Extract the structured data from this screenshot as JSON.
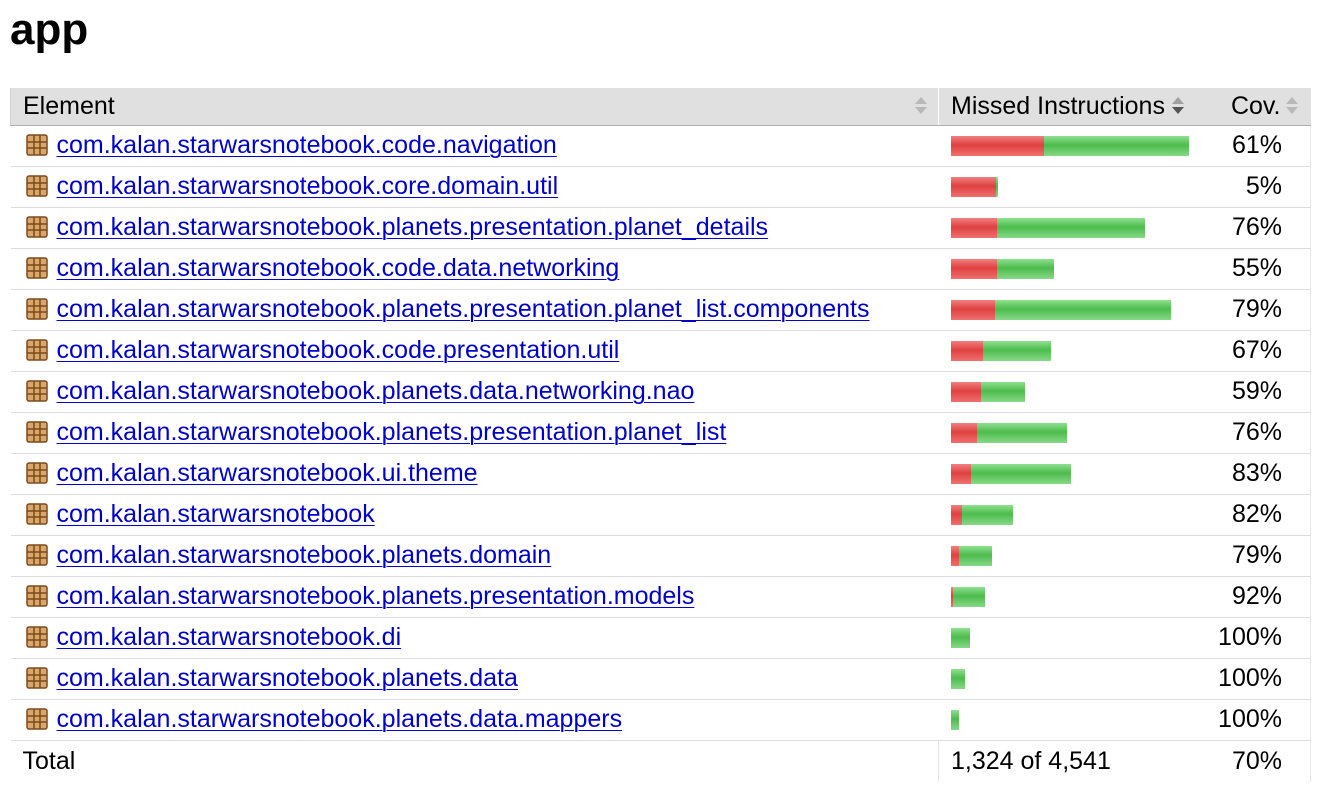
{
  "page": {
    "title": "app"
  },
  "colors": {
    "missed": "#e04040",
    "covered": "#4cbc4c",
    "header_bg": "#e0e0e0",
    "link": "#0000cc"
  },
  "table": {
    "headers": {
      "element": "Element",
      "missed": "Missed Instructions",
      "coverage": "Cov."
    },
    "sort": {
      "active_column": "missed",
      "direction": "descending"
    },
    "max_bar_total": 1000,
    "rows": [
      {
        "icon": "package-icon",
        "name": "com.kalan.starwarsnotebook.code.navigation",
        "missed": 390,
        "covered": 610,
        "coverage": "61%"
      },
      {
        "icon": "package-icon",
        "name": "com.kalan.starwarsnotebook.core.domain.util",
        "missed": 190,
        "covered": 10,
        "coverage": "5%"
      },
      {
        "icon": "package-icon",
        "name": "com.kalan.starwarsnotebook.planets.presentation.planet_details",
        "missed": 195,
        "covered": 620,
        "coverage": "76%"
      },
      {
        "icon": "package-icon",
        "name": "com.kalan.starwarsnotebook.code.data.networking",
        "missed": 195,
        "covered": 240,
        "coverage": "55%"
      },
      {
        "icon": "package-icon",
        "name": "com.kalan.starwarsnotebook.planets.presentation.planet_list.components",
        "missed": 185,
        "covered": 740,
        "coverage": "79%"
      },
      {
        "icon": "package-icon",
        "name": "com.kalan.starwarsnotebook.code.presentation.util",
        "missed": 135,
        "covered": 285,
        "coverage": "67%"
      },
      {
        "icon": "package-icon",
        "name": "com.kalan.starwarsnotebook.planets.data.networking.nao",
        "missed": 125,
        "covered": 185,
        "coverage": "59%"
      },
      {
        "icon": "package-icon",
        "name": "com.kalan.starwarsnotebook.planets.presentation.planet_list",
        "missed": 110,
        "covered": 380,
        "coverage": "76%"
      },
      {
        "icon": "package-icon",
        "name": "com.kalan.starwarsnotebook.ui.theme",
        "missed": 85,
        "covered": 420,
        "coverage": "83%"
      },
      {
        "icon": "package-icon",
        "name": "com.kalan.starwarsnotebook",
        "missed": 45,
        "covered": 215,
        "coverage": "82%"
      },
      {
        "icon": "package-icon",
        "name": "com.kalan.starwarsnotebook.planets.domain",
        "missed": 35,
        "covered": 140,
        "coverage": "79%"
      },
      {
        "icon": "package-icon",
        "name": "com.kalan.starwarsnotebook.planets.presentation.models",
        "missed": 10,
        "covered": 135,
        "coverage": "92%"
      },
      {
        "icon": "package-icon",
        "name": "com.kalan.starwarsnotebook.di",
        "missed": 0,
        "covered": 78,
        "coverage": "100%"
      },
      {
        "icon": "package-icon",
        "name": "com.kalan.starwarsnotebook.planets.data",
        "missed": 0,
        "covered": 60,
        "coverage": "100%"
      },
      {
        "icon": "package-icon",
        "name": "com.kalan.starwarsnotebook.planets.data.mappers",
        "missed": 0,
        "covered": 35,
        "coverage": "100%"
      }
    ],
    "total": {
      "label": "Total",
      "missed_text": "1,324 of 4,541",
      "coverage": "70%"
    }
  }
}
